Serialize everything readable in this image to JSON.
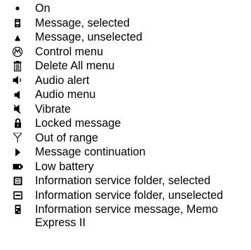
{
  "legend": {
    "items": [
      {
        "icon": "dot-icon",
        "label": "On"
      },
      {
        "icon": "message-selected-icon",
        "label": "Message, selected"
      },
      {
        "icon": "message-unselected-icon",
        "label": "Message, unselected"
      },
      {
        "icon": "motorola-logo-icon",
        "label": "Control menu"
      },
      {
        "icon": "trash-can-icon",
        "label": "Delete All menu"
      },
      {
        "icon": "speaker-sound-icon",
        "label": "Audio alert"
      },
      {
        "icon": "speaker-icon",
        "label": "Audio menu"
      },
      {
        "icon": "speaker-muted-icon",
        "label": "Vibrate"
      },
      {
        "icon": "padlock-icon",
        "label": "Locked message"
      },
      {
        "icon": "antenna-icon",
        "label": "Out of range"
      },
      {
        "icon": "right-triangle-icon",
        "label": "Message continuation"
      },
      {
        "icon": "battery-icon",
        "label": "Low battery"
      },
      {
        "icon": "folder-selected-icon",
        "label": "Information service folder, selected"
      },
      {
        "icon": "folder-unselected-icon",
        "label": "Information service folder, unselected"
      },
      {
        "icon": "memo-express-icon",
        "label": "Information service message, Memo Express II"
      }
    ]
  }
}
